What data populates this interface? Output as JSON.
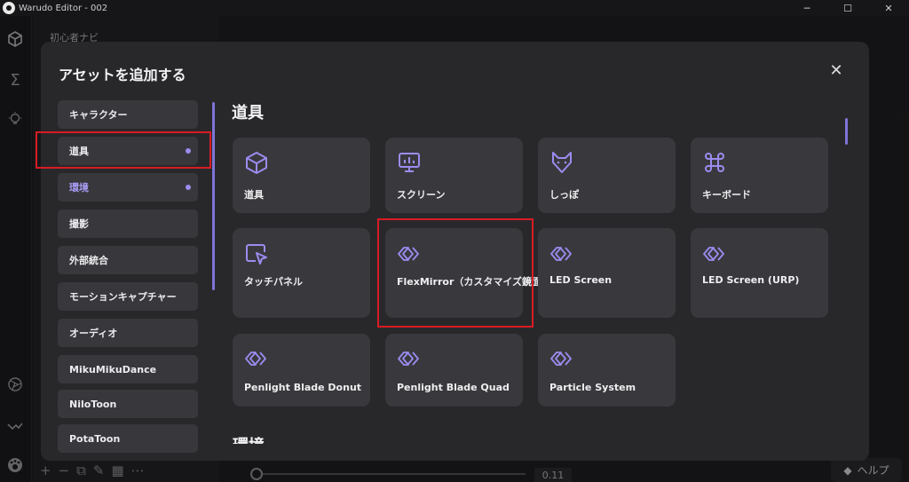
{
  "window": {
    "title": "Warudo Editor - 002",
    "minimize": "─",
    "maximize": "☐",
    "close": "✕"
  },
  "background": {
    "hint": "初心者ナビ",
    "slider_value": "0.11",
    "help_label": "ヘルプ"
  },
  "dialog": {
    "title": "アセットを追加する",
    "close_glyph": "✕",
    "accent_color": "#9b8cf0",
    "highlight_color": "#d81c23",
    "categories": [
      {
        "label": "キャラクター",
        "dot": false,
        "colored": false
      },
      {
        "label": "道具",
        "dot": true,
        "colored": false
      },
      {
        "label": "環境",
        "dot": true,
        "colored": true
      },
      {
        "label": "撮影",
        "dot": false,
        "colored": false
      },
      {
        "label": "外部統合",
        "dot": false,
        "colored": false
      },
      {
        "label": "モーションキャプチャー",
        "dot": false,
        "colored": false
      },
      {
        "label": "オーディオ",
        "dot": false,
        "colored": false
      },
      {
        "label": "MikuMikuDance",
        "dot": false,
        "colored": false
      },
      {
        "label": "NiloToon",
        "dot": false,
        "colored": false
      },
      {
        "label": "PotaToon",
        "dot": false,
        "colored": false
      }
    ],
    "section_title": "道具",
    "next_section_title": "環境",
    "cards": [
      {
        "label": "道具",
        "icon": "cube-icon"
      },
      {
        "label": "スクリーン",
        "icon": "screen-icon"
      },
      {
        "label": "しっぽ",
        "icon": "fox-icon"
      },
      {
        "label": "キーボード",
        "icon": "command-key-icon"
      },
      {
        "label": "タッチパネル",
        "icon": "touch-panel-icon"
      },
      {
        "label": "FlexMirror（カスタマイズ鏡面）",
        "icon": "chevrons-icon"
      },
      {
        "label": "LED Screen",
        "icon": "chevrons-icon"
      },
      {
        "label": "LED Screen (URP)",
        "icon": "chevrons-icon"
      },
      {
        "label": "Penlight Blade Donut",
        "icon": "chevrons-icon"
      },
      {
        "label": "Penlight Blade Quad",
        "icon": "chevrons-icon"
      },
      {
        "label": "Particle System",
        "icon": "chevrons-icon"
      }
    ]
  }
}
